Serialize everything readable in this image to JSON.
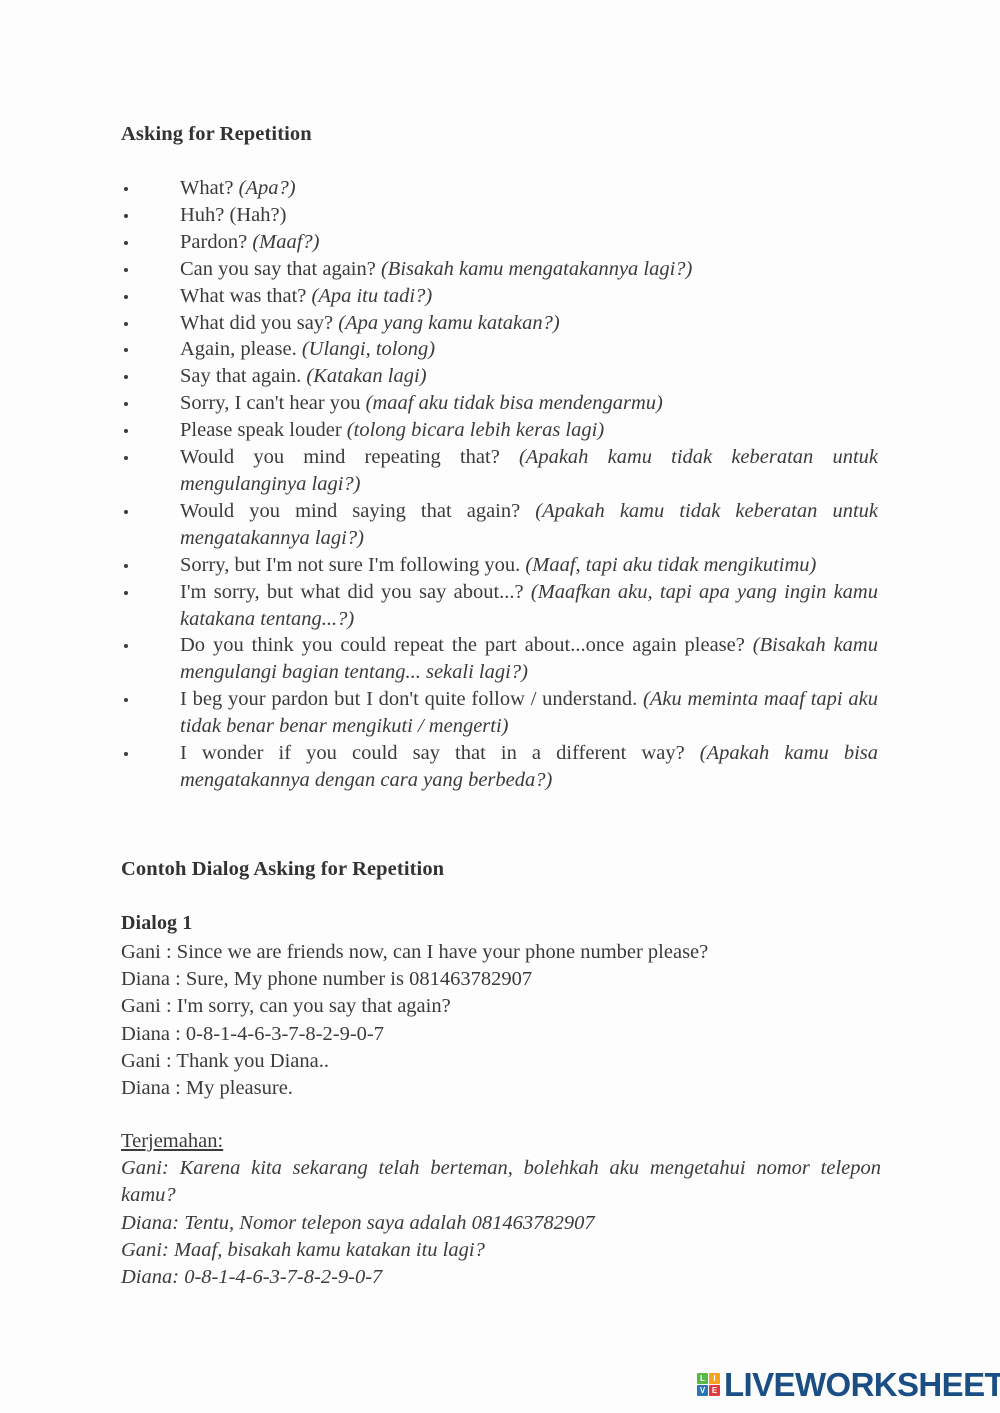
{
  "document": {
    "heading_asking": "Asking for Repetition",
    "heading_contoh": "Contoh Dialog Asking for Repetition",
    "heading_dialog1": "Dialog 1"
  },
  "phrases": [
    {
      "en": "What? ",
      "id": "(Apa?)",
      "italic": true,
      "multiline": false
    },
    {
      "en": "Huh? (Hah?)",
      "id": "",
      "italic": false,
      "multiline": false
    },
    {
      "en": "Pardon? ",
      "id": "(Maaf?)",
      "italic": true,
      "multiline": false
    },
    {
      "en": "Can you say that again? ",
      "id": "(Bisakah kamu mengatakannya lagi?)",
      "italic": true,
      "multiline": false
    },
    {
      "en": "What was that? ",
      "id": "(Apa itu tadi?)",
      "italic": true,
      "multiline": false
    },
    {
      "en": "What did you say? ",
      "id": "(Apa yang kamu katakan?)",
      "italic": true,
      "multiline": false
    },
    {
      "en": "Again, please. ",
      "id": "(Ulangi, tolong)",
      "italic": true,
      "multiline": false
    },
    {
      "en": "Say that again. ",
      "id": "(Katakan lagi)",
      "italic": true,
      "multiline": false
    },
    {
      "en": "Sorry, I can't hear you ",
      "id": "(maaf aku tidak bisa mendengarmu)",
      "italic": true,
      "multiline": false
    },
    {
      "en": "Please speak louder ",
      "id": "(tolong bicara lebih keras lagi)",
      "italic": true,
      "multiline": false
    },
    {
      "en": "Would you mind repeating that? ",
      "id": "(Apakah kamu tidak keberatan untuk mengulanginya lagi?)",
      "italic": true,
      "multiline": true
    },
    {
      "en": "Would you mind saying that again? ",
      "id": "(Apakah kamu tidak keberatan untuk mengatakannya lagi?)",
      "italic": true,
      "multiline": true
    },
    {
      "en": "Sorry, but I'm not sure I'm following you. ",
      "id": "(Maaf, tapi aku tidak mengikutimu)",
      "italic": true,
      "multiline": true
    },
    {
      "en": "I'm sorry, but what did you say about...? ",
      "id": "(Maafkan aku, tapi apa yang ingin kamu katakana      tentang...?)",
      "italic": true,
      "multiline": true
    },
    {
      "en": "Do you think you could repeat the part about...once again please? ",
      "id": "(Bisakah kamu  mengulangi bagian tentang... sekali lagi?)",
      "italic": true,
      "multiline": true
    },
    {
      "en": "I beg your pardon but I don't quite follow / understand. ",
      "id": "(Aku meminta maaf tapi aku tidak benar      benar mengikuti / mengerti)",
      "italic": true,
      "multiline": true
    },
    {
      "en": "I wonder if you could say that in a different way? ",
      "id": "(Apakah kamu bisa mengatakannya dengan   cara yang berbeda?)",
      "italic": true,
      "multiline": true
    }
  ],
  "dialog": {
    "lines": [
      "Gani : Since we are friends now, can I have your phone number please?",
      "Diana : Sure, My phone number is 081463782907",
      "Gani : I'm sorry, can you say that again?",
      "Diana : 0-8-1-4-6-3-7-8-2-9-0-7",
      "Gani : Thank you Diana..",
      "Diana : My pleasure."
    ]
  },
  "translation": {
    "title": "Terjemahan:",
    "lines": [
      "Gani: Karena kita sekarang telah berteman, bolehkah aku mengetahui nomor telepon kamu?",
      "Diana: Tentu, Nomor telepon saya adalah 081463782907",
      "Gani: Maaf, bisakah kamu katakan itu lagi?",
      "Diana: 0-8-1-4-6-3-7-8-2-9-0-7"
    ],
    "justify_flags": [
      true,
      false,
      false,
      false
    ]
  },
  "footer": {
    "logo_text": "LIVEWORKSHEETS",
    "logo_cells": [
      "L",
      "I",
      "V",
      "E"
    ],
    "logo_colors": {
      "l": "#58b947",
      "i": "#f5a21d",
      "v": "#2e73b8",
      "e": "#e03a3e",
      "wordmark": "#1b4e84"
    }
  }
}
